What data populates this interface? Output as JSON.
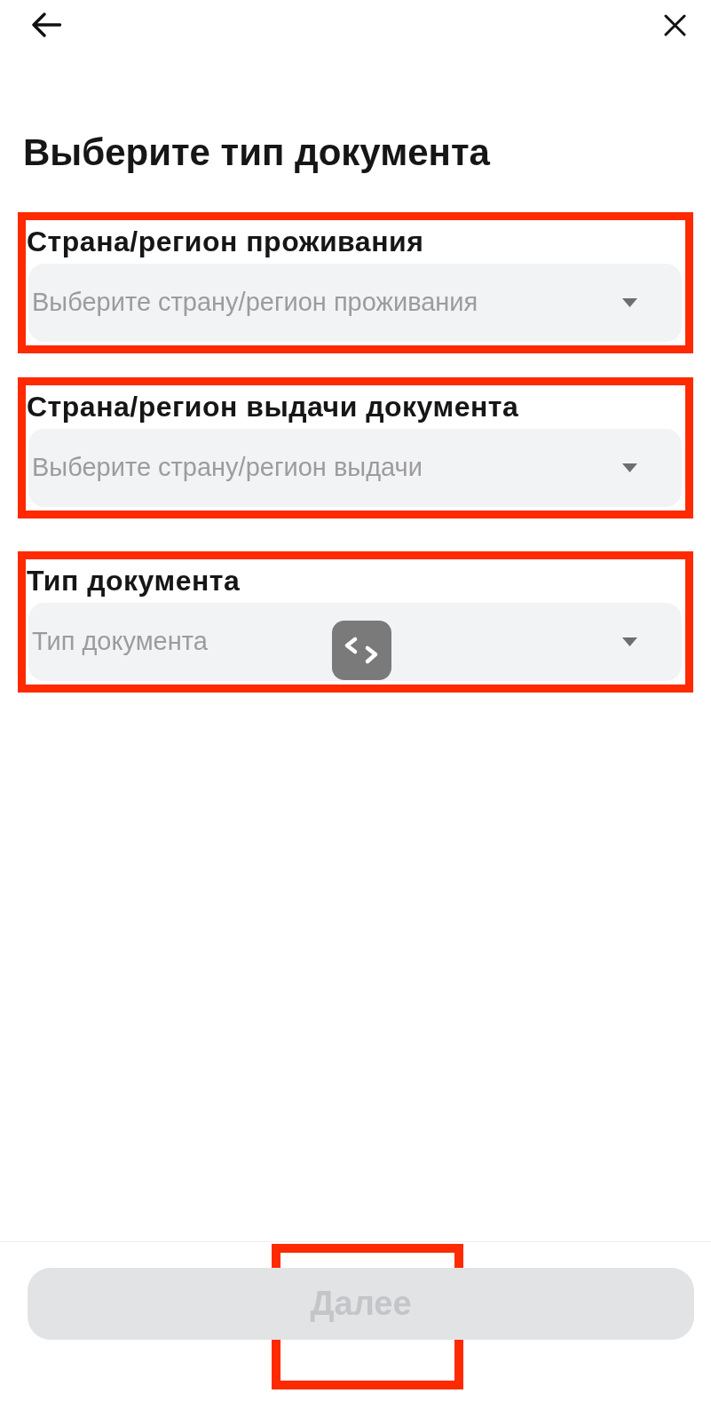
{
  "title": "Выберите тип документа",
  "fields": [
    {
      "label": "Страна/регион проживания",
      "placeholder": "Выберите страну/регион проживания",
      "highlighted": true
    },
    {
      "label": "Страна/регион выдачи документа",
      "placeholder": "Выберите страну/регион выдачи",
      "highlighted": true
    },
    {
      "label": "Тип документа",
      "placeholder": "Тип документа",
      "highlighted": true
    }
  ],
  "next_button": {
    "label": "Далее",
    "disabled": true,
    "highlighted": true
  }
}
